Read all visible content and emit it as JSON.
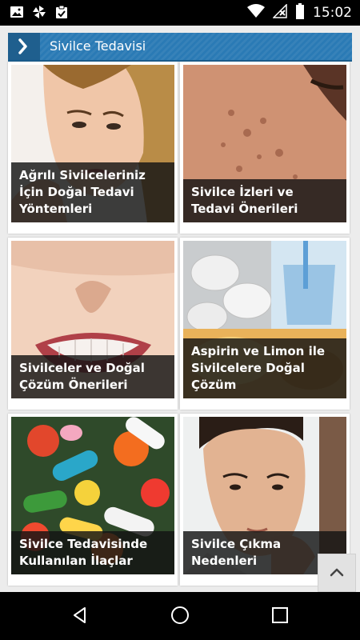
{
  "status_bar": {
    "time": "15:02",
    "icons": [
      "image-icon",
      "pinwheel-icon",
      "clipboard-icon",
      "wifi-icon",
      "no-signal-icon",
      "battery-icon"
    ]
  },
  "header": {
    "title": "Sivilce Tedavisi",
    "icon": "chevron-right-icon",
    "color": "#2a7ab5"
  },
  "articles": [
    {
      "title": "Ağrılı Sivilceleriniz İçin Doğal Tedavi Yöntemleri",
      "image": "woman-touching-face"
    },
    {
      "title": "Sivilce İzleri ve Tedavi Önerileri",
      "image": "acne-scarred-cheek"
    },
    {
      "title": "Sivilceler ve Doğal Çözüm Önerileri",
      "image": "grimacing-mouth"
    },
    {
      "title": "Aspirin ve Limon ile Sivilcelere Doğal Çözüm",
      "image": "aspirin-tablets-and-water"
    },
    {
      "title": "Sivilce Tedavisinde Kullanılan İlaçlar",
      "image": "colorful-pills"
    },
    {
      "title": "Sivilce Çıkma Nedenleri",
      "image": "man-in-mirror"
    }
  ],
  "scroll_top_icon": "chevron-up-icon",
  "nav_bar": {
    "icons": [
      "back-icon",
      "home-icon",
      "recents-icon"
    ]
  }
}
